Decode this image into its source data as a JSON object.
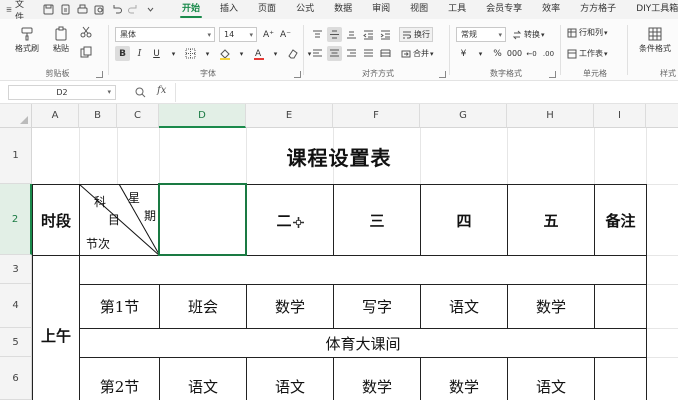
{
  "menu": {
    "file_label": "文件",
    "tabs": [
      "开始",
      "插入",
      "页面",
      "公式",
      "数据",
      "审阅",
      "视图",
      "工具",
      "会员专享",
      "效率",
      "方方格子",
      "DIY工具箱"
    ],
    "active_tab": "开始"
  },
  "ribbon": {
    "clipboard": {
      "label": "剪贴板",
      "format_painter": "格式刷",
      "paste": "粘贴"
    },
    "font": {
      "label": "字体",
      "font_name": "黑体",
      "font_size": "14"
    },
    "align": {
      "label": "对齐方式",
      "wrap": "换行",
      "merge": "合并"
    },
    "number": {
      "label": "数字格式",
      "format": "常规",
      "convert": "转换"
    },
    "cells": {
      "label": "单元格",
      "row_col": "行和列",
      "sheet": "工作表"
    },
    "styles": {
      "label": "样式",
      "cond_format": "条件格式"
    }
  },
  "formula_bar": {
    "cell_ref": "D2",
    "fx": "fx",
    "value": ""
  },
  "columns": [
    "A",
    "B",
    "C",
    "D",
    "E",
    "F",
    "G",
    "H",
    "I"
  ],
  "selected_column": "D",
  "rows": [
    "1",
    "2",
    "3",
    "4",
    "5",
    "6"
  ],
  "selected_row": "2",
  "sheet": {
    "title": "课程设置表",
    "period_label": "时段",
    "diag_star": "星",
    "diag_week": "期",
    "diag_subject": "科",
    "diag_eye": "目",
    "diag_section": "节次",
    "weekdays": [
      "",
      "二",
      "三",
      "四",
      "五"
    ],
    "remark": "备注",
    "morning": "上午",
    "row4_section": "第1节",
    "row4_subjects": [
      "班会",
      "数学",
      "写字",
      "语文",
      "数学"
    ],
    "row5_merged": "体育大课间",
    "row6_section": "第2节",
    "row6_subjects": [
      "语文",
      "语文",
      "数学",
      "数学",
      "语文"
    ]
  }
}
